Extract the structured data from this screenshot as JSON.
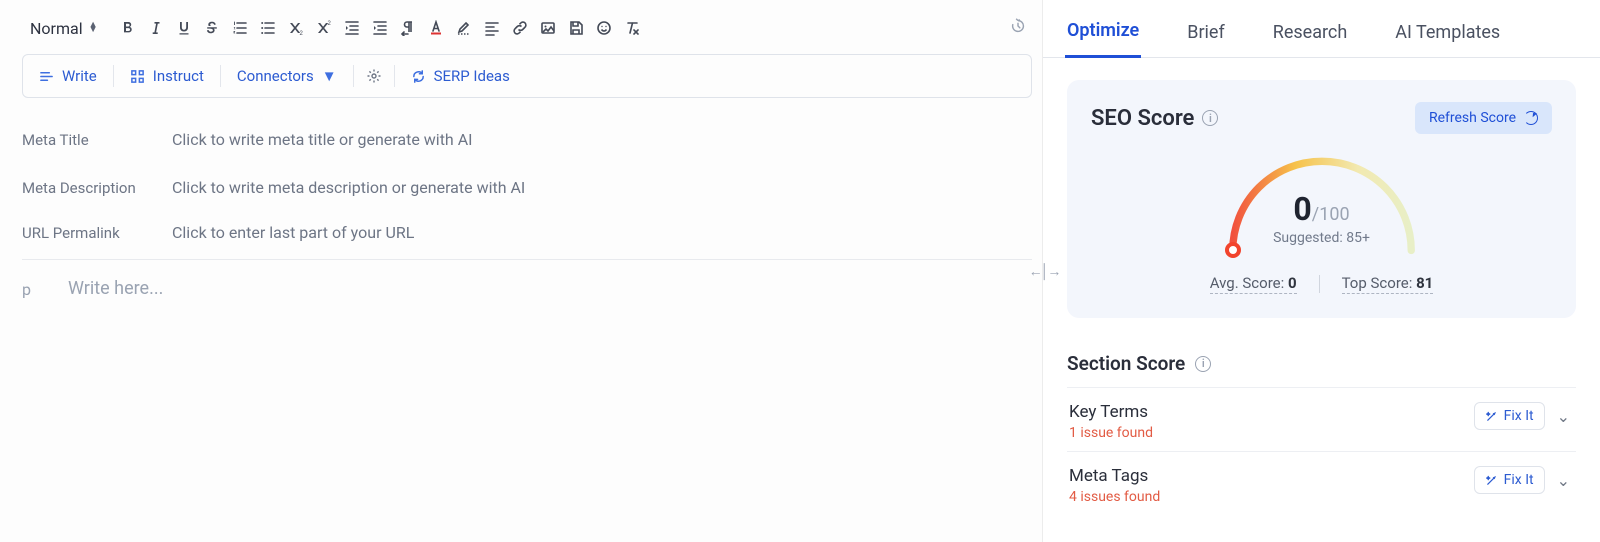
{
  "toolbar": {
    "style_label": "Normal"
  },
  "action_bar": {
    "write": "Write",
    "instruct": "Instruct",
    "connectors": "Connectors",
    "serp": "SERP Ideas"
  },
  "meta": {
    "title_label": "Meta Title",
    "title_placeholder": "Click to write meta title or generate with AI",
    "desc_label": "Meta Description",
    "desc_placeholder": "Click to write meta description or generate with AI",
    "url_label": "URL Permalink",
    "url_placeholder": "Click to enter last part of your URL"
  },
  "editor": {
    "block": "p",
    "placeholder": "Write here..."
  },
  "tabs": {
    "optimize": "Optimize",
    "brief": "Brief",
    "research": "Research",
    "ai_templates": "AI Templates"
  },
  "seo": {
    "title": "SEO Score",
    "refresh": "Refresh Score",
    "score": "0",
    "score_of": "/100",
    "suggested_label": "Suggested: ",
    "suggested_value": "85+",
    "avg_label": "Avg. Score: ",
    "avg_value": "0",
    "top_label": "Top Score: ",
    "top_value": "81"
  },
  "section_score": {
    "title": "Section Score",
    "items": [
      {
        "name": "Key Terms",
        "issues": "1 issue found",
        "fix": "Fix It"
      },
      {
        "name": "Meta Tags",
        "issues": "4 issues found",
        "fix": "Fix It"
      }
    ]
  }
}
